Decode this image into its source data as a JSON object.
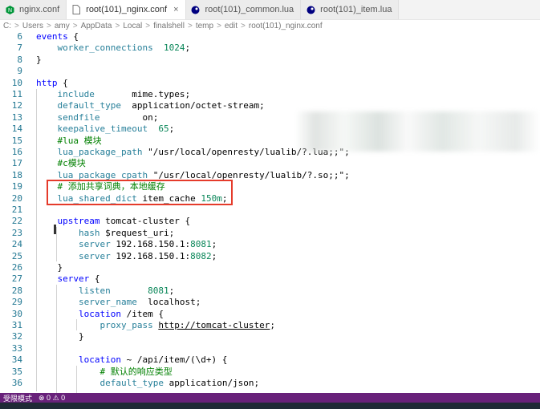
{
  "tabs": [
    {
      "label": "nginx.conf",
      "active": false,
      "icon": "nginx-icon"
    },
    {
      "label": "root(101)_nginx.conf",
      "active": true,
      "icon": "file-icon"
    },
    {
      "label": "root(101)_common.lua",
      "active": false,
      "icon": "lua-icon"
    },
    {
      "label": "root(101)_item.lua",
      "active": false,
      "icon": "lua-icon"
    }
  ],
  "tab_close": "×",
  "breadcrumb": [
    "C:",
    "Users",
    "amy",
    "AppData",
    "Local",
    "finalshell",
    "temp",
    "edit",
    "root(101)_nginx.conf"
  ],
  "lines": [
    {
      "n": "6",
      "code": "events {"
    },
    {
      "n": "7",
      "code": "    worker_connections  1024;"
    },
    {
      "n": "8",
      "code": "}"
    },
    {
      "n": "9",
      "code": ""
    },
    {
      "n": "10",
      "code": "http {"
    },
    {
      "n": "11",
      "code": "    include       mime.types;"
    },
    {
      "n": "12",
      "code": "    default_type  application/octet-stream;"
    },
    {
      "n": "13",
      "code": "    sendfile        on;"
    },
    {
      "n": "14",
      "code": "    keepalive_timeout  65;"
    },
    {
      "n": "15",
      "code": "    #lua 模块"
    },
    {
      "n": "16",
      "code": "    lua_package_path \"/usr/local/openresty/lualib/?.lua;;\";"
    },
    {
      "n": "17",
      "code": "    #c模块"
    },
    {
      "n": "18",
      "code": "    lua_package_cpath \"/usr/local/openresty/lualib/?.so;;\";"
    },
    {
      "n": "19",
      "code": "    # 添加共享词典，本地缓存"
    },
    {
      "n": "20",
      "code": "    lua_shared_dict item_cache 150m;"
    },
    {
      "n": "21",
      "code": ""
    },
    {
      "n": "22",
      "code": "    upstream tomcat-cluster {"
    },
    {
      "n": "23",
      "code": "        hash $request_uri;"
    },
    {
      "n": "24",
      "code": "        server 192.168.150.1:8081;"
    },
    {
      "n": "25",
      "code": "        server 192.168.150.1:8082;"
    },
    {
      "n": "26",
      "code": "    }"
    },
    {
      "n": "27",
      "code": "    server {"
    },
    {
      "n": "28",
      "code": "        listen       8081;"
    },
    {
      "n": "29",
      "code": "        server_name  localhost;"
    },
    {
      "n": "30",
      "code": "        location /item {"
    },
    {
      "n": "31",
      "code": "            proxy_pass http://tomcat-cluster;"
    },
    {
      "n": "32",
      "code": "        }"
    },
    {
      "n": "33",
      "code": ""
    },
    {
      "n": "34",
      "code": "        location ~ /api/item/(\\d+) {"
    },
    {
      "n": "35",
      "code": "            # 默认的响应类型"
    },
    {
      "n": "36",
      "code": "            default_type application/json;"
    }
  ],
  "status": {
    "mode": "受限模式",
    "problems": "⊗ 0 ⚠ 0"
  },
  "colors": {
    "accent": "#68217a",
    "highlight_box": "#e53b2b"
  }
}
